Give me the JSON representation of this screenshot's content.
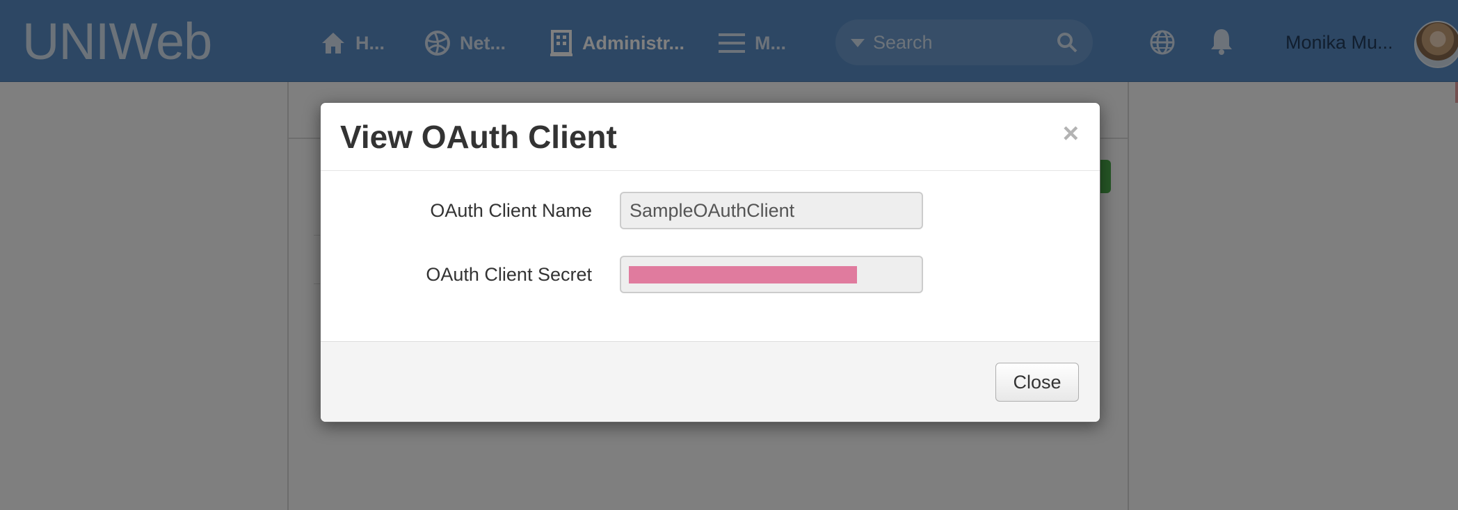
{
  "header": {
    "logo": "UNIWeb",
    "nav": [
      {
        "label": "H...",
        "icon": "home-icon"
      },
      {
        "label": "Net...",
        "icon": "network-icon"
      },
      {
        "label": "Administr...",
        "icon": "building-icon"
      },
      {
        "label": "M...",
        "icon": "menu-icon"
      }
    ],
    "search": {
      "placeholder": "Search"
    },
    "user_name": "Monika Mu..."
  },
  "modal": {
    "title": "View OAuth Client",
    "close_symbol": "×",
    "fields": [
      {
        "label": "OAuth Client Name",
        "value": "SampleOAuthClient"
      },
      {
        "label": "OAuth Client Secret",
        "value": ""
      }
    ],
    "close_label": "Close"
  },
  "colors": {
    "header_bg": "#5b8fc8",
    "redaction": "#e07b9e"
  }
}
